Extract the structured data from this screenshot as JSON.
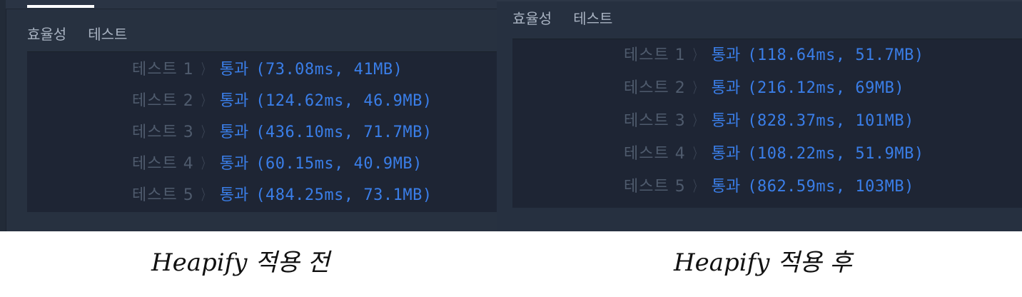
{
  "before": {
    "tabs": [
      "효율성",
      "테스트"
    ],
    "rows": [
      {
        "label": "테스트 1",
        "status": "통과",
        "detail": "(73.08ms, 41MB)"
      },
      {
        "label": "테스트 2",
        "status": "통과",
        "detail": "(124.62ms, 46.9MB)"
      },
      {
        "label": "테스트 3",
        "status": "통과",
        "detail": "(436.10ms, 71.7MB)"
      },
      {
        "label": "테스트 4",
        "status": "통과",
        "detail": "(60.15ms, 40.9MB)"
      },
      {
        "label": "테스트 5",
        "status": "통과",
        "detail": "(484.25ms, 73.1MB)"
      }
    ],
    "caption": "Heapify 적용 전"
  },
  "after": {
    "tabs": [
      "효율성",
      "테스트"
    ],
    "rows": [
      {
        "label": "테스트 1",
        "status": "통과",
        "detail": "(118.64ms, 51.7MB)"
      },
      {
        "label": "테스트 2",
        "status": "통과",
        "detail": "(216.12ms, 69MB)"
      },
      {
        "label": "테스트 3",
        "status": "통과",
        "detail": "(828.37ms, 101MB)"
      },
      {
        "label": "테스트 4",
        "status": "통과",
        "detail": "(108.22ms, 51.9MB)"
      },
      {
        "label": "테스트 5",
        "status": "통과",
        "detail": "(862.59ms, 103MB)"
      }
    ],
    "caption": "Heapify 적용 후"
  },
  "colors": {
    "panel_bg": "#273140",
    "result_bg": "#1e2534",
    "pass_text": "#3a7ee8",
    "label_text": "#4f5b6d",
    "heading_text": "#a8b2c1"
  },
  "icons": {
    "row_separator": "chevron-right-icon"
  }
}
